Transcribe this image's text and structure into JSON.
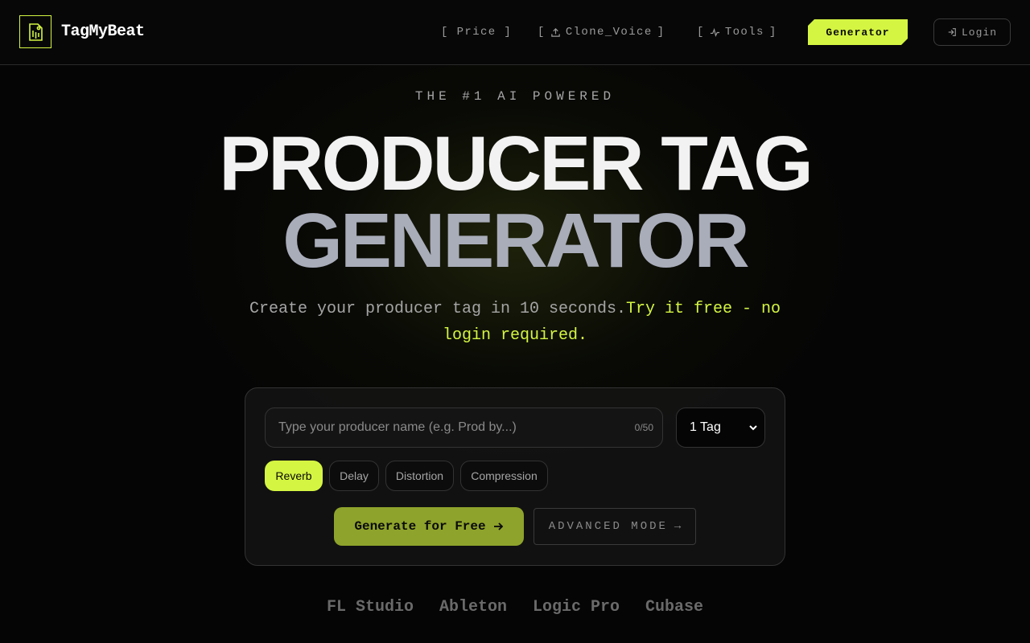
{
  "header": {
    "brand": "TagMyBeat",
    "nav": [
      {
        "label": "[ Price ]"
      },
      {
        "label_open": "[",
        "label": "Clone_Voice",
        "label_close": "]"
      },
      {
        "label_open": "[",
        "label": "Tools",
        "label_close": "]"
      }
    ],
    "generator_label": "Generator",
    "login_label": "Login",
    "colors": {
      "accent": "#d4f542"
    }
  },
  "hero": {
    "eyebrow": "THE #1 AI POWERED",
    "title_line1": "PRODUCER TAG",
    "title_line2": "GENERATOR",
    "subtitle_main": "Create your producer tag in 10 seconds.",
    "subtitle_accent": "Try it free - no login required."
  },
  "form": {
    "name_placeholder": "Type your producer name (e.g. Prod by...)",
    "name_value": "",
    "counter": "0/50",
    "tag_count_selected": "1 Tag",
    "effects": [
      {
        "label": "Reverb",
        "active": true
      },
      {
        "label": "Delay",
        "active": false
      },
      {
        "label": "Distortion",
        "active": false
      },
      {
        "label": "Compression",
        "active": false
      }
    ],
    "generate_label": "Generate for Free",
    "advanced_label": "ADVANCED MODE"
  },
  "daws": [
    "FL Studio",
    "Ableton",
    "Logic Pro",
    "Cubase"
  ]
}
